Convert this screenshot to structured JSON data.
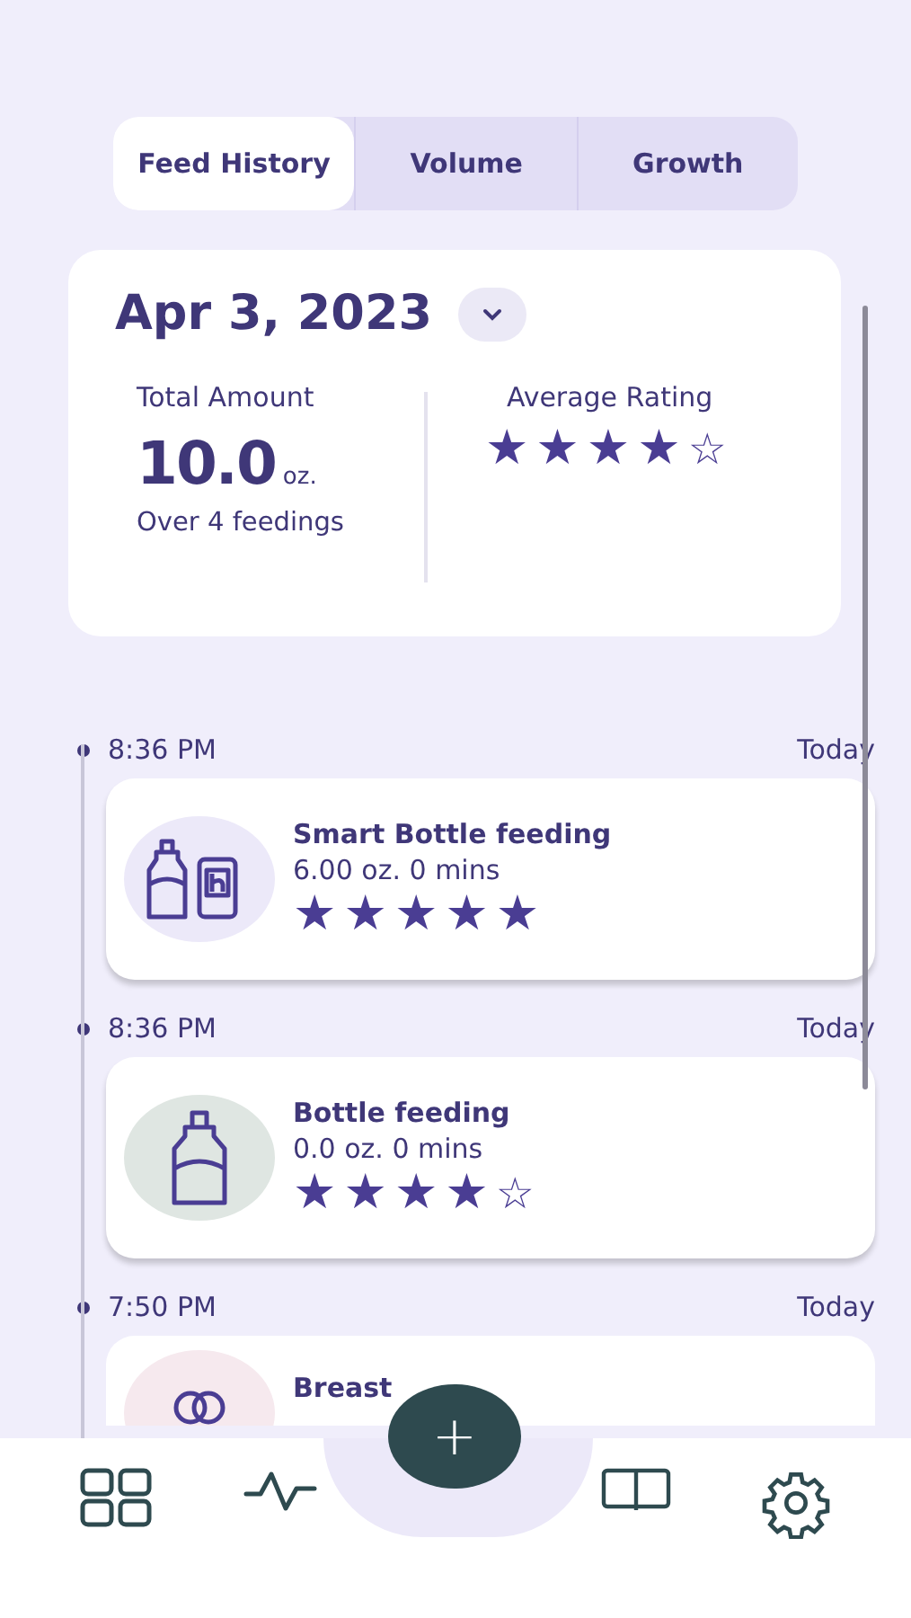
{
  "tabs": [
    {
      "label": "Feed History",
      "selected": true
    },
    {
      "label": "Volume",
      "selected": false
    },
    {
      "label": "Growth",
      "selected": false
    }
  ],
  "summary": {
    "date": "Apr 3, 2023",
    "total_label": "Total Amount",
    "total_value": "10.0",
    "total_unit": "oz.",
    "total_note": "Over 4 feedings",
    "rating_label": "Average Rating",
    "stars": 4
  },
  "feedings": [
    {
      "time": "8:36 PM",
      "day": "Today",
      "kind": "smart_bottle",
      "title": "Smart Bottle feeding",
      "detail": "6.00 oz.  0 mins",
      "stars": 5
    },
    {
      "time": "8:36 PM",
      "day": "Today",
      "kind": "bottle",
      "title": "Bottle feeding",
      "detail": "0.0 oz.  0 mins",
      "stars": 4
    },
    {
      "time": "7:50 PM",
      "day": "Today",
      "kind": "breast",
      "title": "Breast"
    }
  ],
  "fab": "+"
}
